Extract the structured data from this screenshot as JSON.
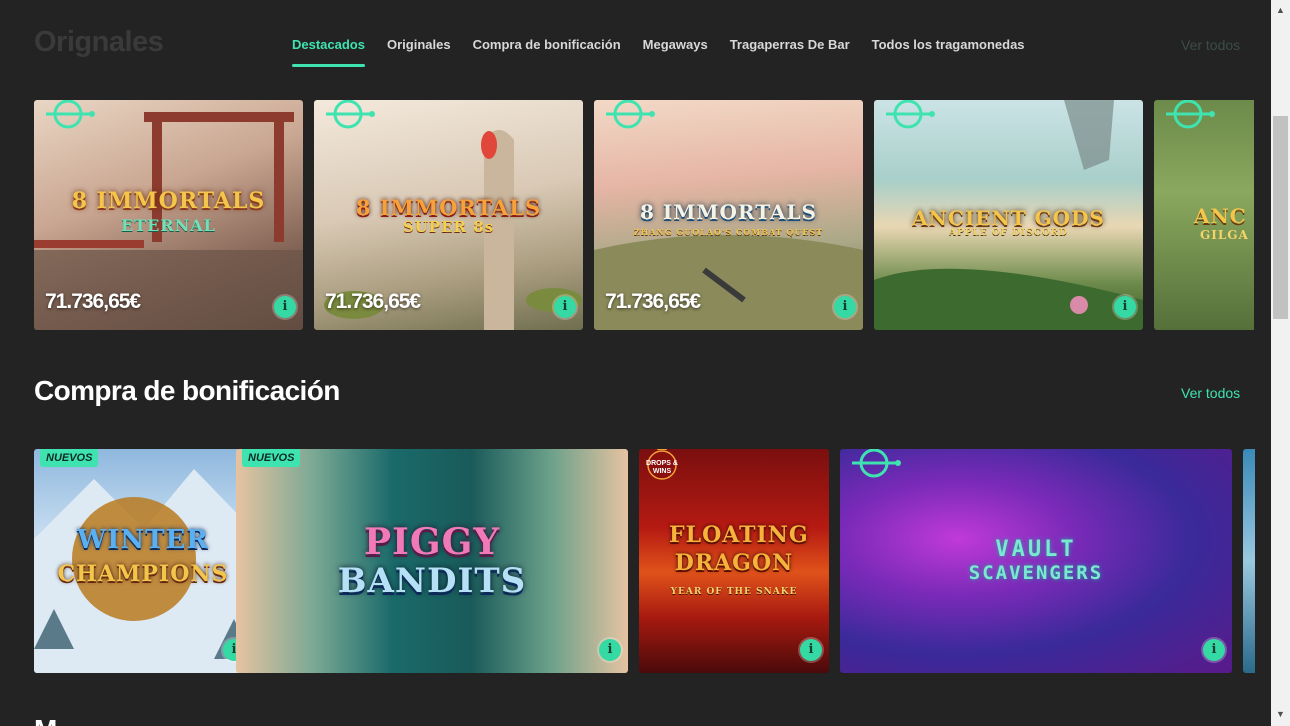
{
  "top_section": {
    "title": "Orignales",
    "see_all": "Ver todos",
    "tabs": [
      {
        "label": "Destacados",
        "active": true
      },
      {
        "label": "Originales",
        "active": false
      },
      {
        "label": "Compra de bonificación",
        "active": false
      },
      {
        "label": "Megaways",
        "active": false
      },
      {
        "label": "Tragaperras De Bar",
        "active": false
      },
      {
        "label": "Todos los tragamonedas",
        "active": false
      }
    ],
    "games": [
      {
        "logo": "8 IMMORTALS",
        "logo_sub": "ETERNAL",
        "jackpot": "71.736,65€",
        "icon": "drop-jackpot-icon"
      },
      {
        "logo": "8 IMMORTALS",
        "logo_sub": "SUPER 8s",
        "jackpot": "71.736,65€",
        "icon": "drop-jackpot-icon"
      },
      {
        "logo": "8 IMMORTALS",
        "logo_sub": "ZHANG GUOLAO'S COMBAT QUEST",
        "jackpot": "71.736,65€",
        "icon": "drop-jackpot-icon"
      },
      {
        "logo": "ANCIENT GODS",
        "logo_sub": "APPLE OF DISCORD",
        "jackpot": "",
        "icon": "drop-jackpot-icon"
      },
      {
        "logo": "ANC",
        "logo_sub": "GILGA",
        "jackpot": "",
        "icon": "drop-jackpot-icon"
      }
    ]
  },
  "bonus_section": {
    "title": "Compra de bonificación",
    "see_all": "Ver todos",
    "games": [
      {
        "badge": "NUEVOS",
        "logo": "WINTER",
        "logo_sub": "CHAMPIONS"
      },
      {
        "badge": "NUEVOS",
        "logo": "PIGGY",
        "logo_sub": "BANDITS"
      },
      {
        "badge": "DROPS & WINS",
        "logo": "FLOATING DRAGON",
        "logo_sub": "YEAR OF THE SNAKE"
      },
      {
        "badge": "",
        "logo": "VAULT",
        "logo_sub": "SCAVENGERS"
      }
    ]
  },
  "next_section_peek": "M",
  "info_glyph": "i",
  "scrollbar": {
    "up": "▲",
    "down": "▼"
  },
  "colors": {
    "accent": "#3fe3b0",
    "background": "#232323",
    "info_button": "#35d9a3"
  }
}
